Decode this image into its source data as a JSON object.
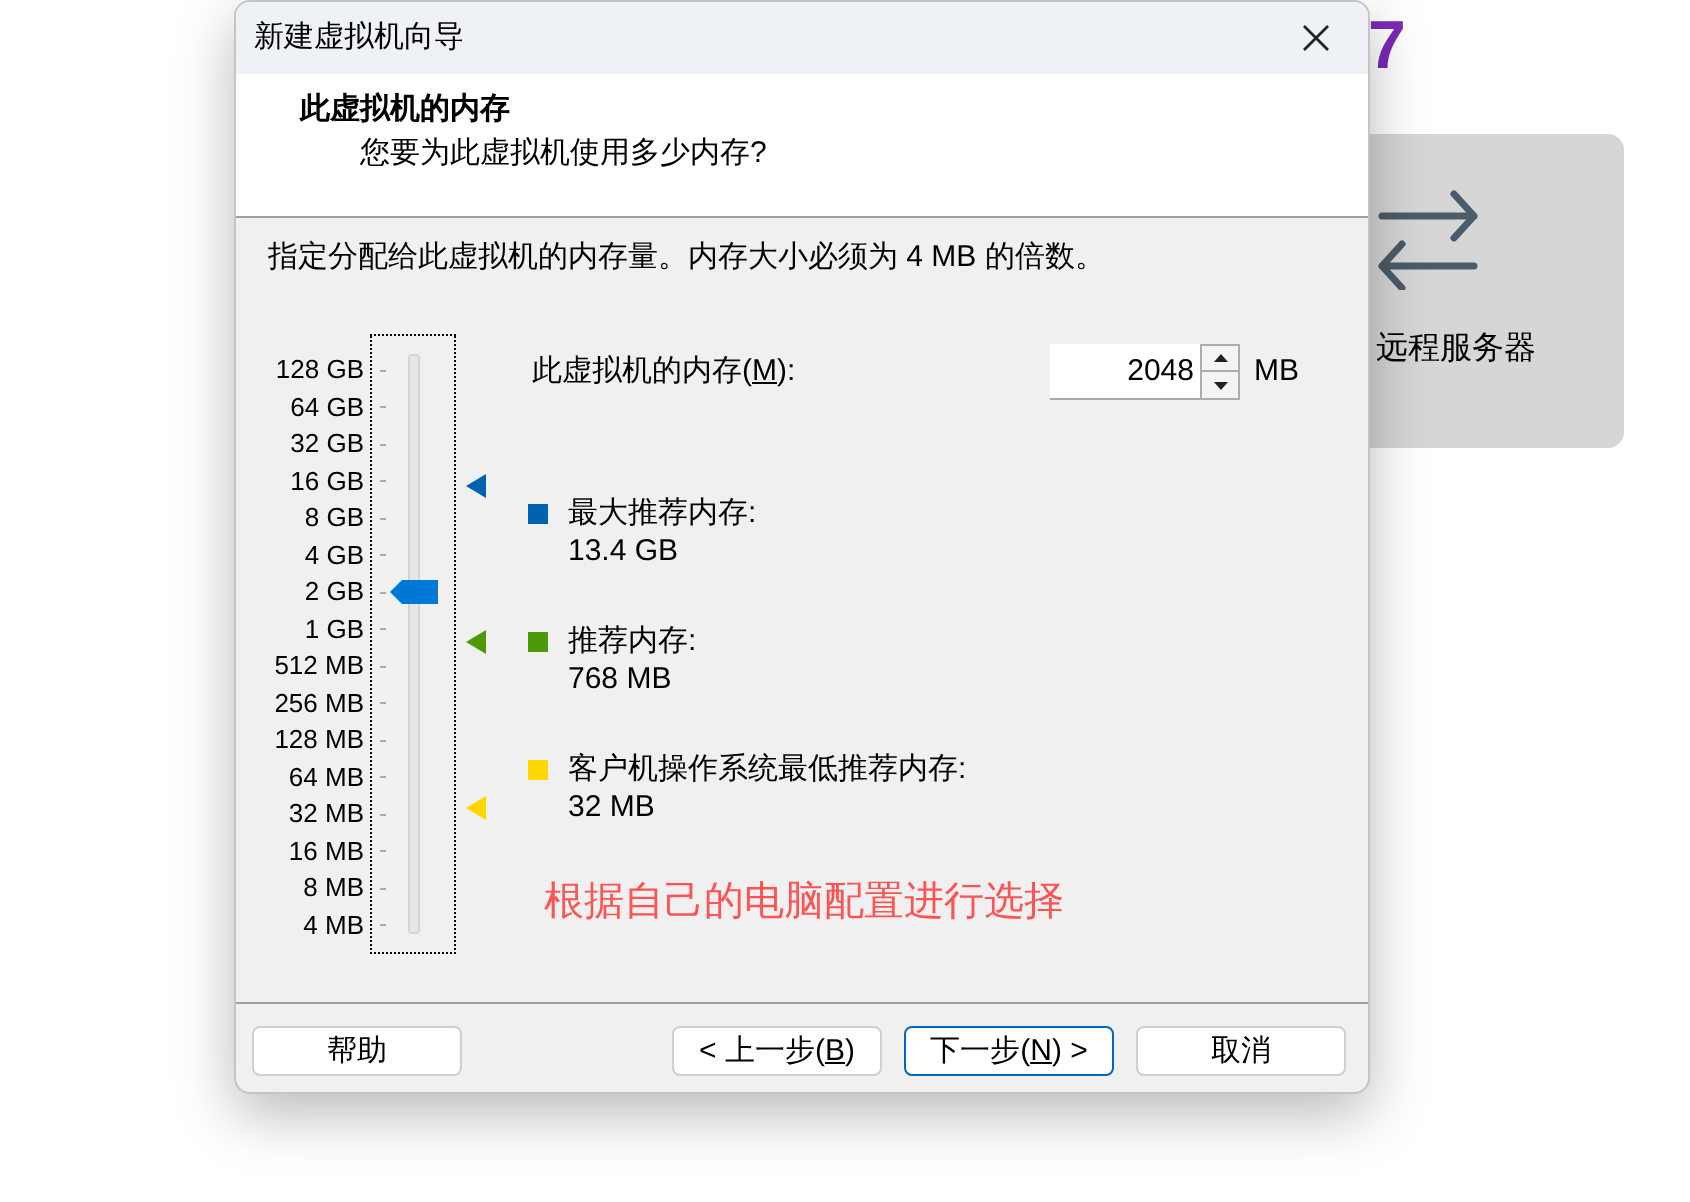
{
  "background": {
    "partial_heading": "7",
    "card_label": "远程服务器"
  },
  "dialog": {
    "title": "新建虚拟机向导"
  },
  "header": {
    "title": "此虚拟机的内存",
    "subtitle": "您要为此虚拟机使用多少内存?"
  },
  "description": "指定分配给此虚拟机的内存量。内存大小必须为 4 MB 的倍数。",
  "memory_slider": {
    "ticks": [
      "128 GB",
      "64 GB",
      "32 GB",
      "16 GB",
      "8 GB",
      "4 GB",
      "2 GB",
      "1 GB",
      "512 MB",
      "256 MB",
      "128 MB",
      "64 MB",
      "32 MB",
      "16 MB",
      "8 MB",
      "4 MB"
    ],
    "level": 0.6
  },
  "memory_field": {
    "label": "此虚拟机的内存(",
    "mnemonic": "M",
    "label_end": "):",
    "value": "2048",
    "unit": "MB"
  },
  "recommendations": [
    {
      "label": "最大推荐内存:",
      "value": "13.4 GB",
      "color": "#0063b1",
      "level": 0.79
    },
    {
      "label": "推荐内存:",
      "value": "768 MB",
      "color": "#4e9a06",
      "level": 0.51
    },
    {
      "label": "客户机操作系统最低推荐内存:",
      "value": "32 MB",
      "color": "#ffd700",
      "level": 0.21
    }
  ],
  "annotation": "根据自己的电脑配置进行选择",
  "buttons": [
    {
      "label": "帮助",
      "default": false
    },
    {
      "label": "< 上一步(",
      "mnemonic": "B",
      "label_end": ")",
      "default": false
    },
    {
      "label": "下一步(",
      "mnemonic": "N",
      "label_end": ") >",
      "default": true
    },
    {
      "label": "取消",
      "default": false
    }
  ]
}
